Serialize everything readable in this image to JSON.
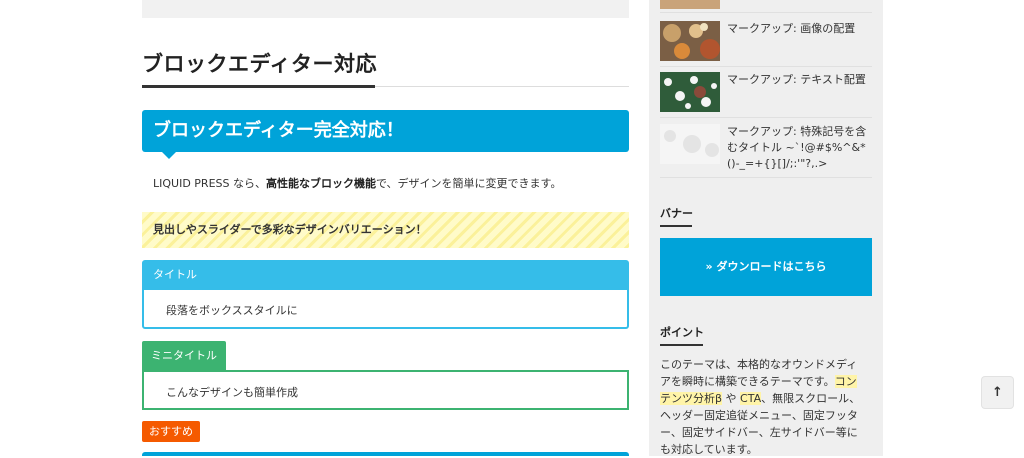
{
  "main": {
    "section_title": "ブロックエディター対応",
    "blue_heading": "ブロックエディター完全対応！",
    "paragraph": {
      "before": "LIQUID PRESS なら、",
      "bold": "高性能なブロック機能",
      "after": "で、デザインを簡単に変更できます。"
    },
    "stripe_text": "見出しやスライダーで多彩なデザインバリエーション！",
    "box_title": "タイトル",
    "box_body": "段落をボックススタイルに",
    "mini_title": "ミニタイトル",
    "mini_body": "こんなデザインも簡単作成",
    "badge": "おすすめ"
  },
  "sidebar": {
    "posts": [
      {
        "title": "マークアップ: 画像の配置"
      },
      {
        "title": "マークアップ: テキスト配置"
      },
      {
        "title": "マークアップ: 特殊記号を含むタイトル ~`!@#$%^&*()-_=+{}[]/;:'\"?,.>"
      }
    ],
    "banner_heading": "バナー",
    "download_label": "» ダウンロードはこちら",
    "point_heading": "ポイント",
    "point_text": {
      "p1": "このテーマは、本格的なオウンドメディアを瞬時に構築できるテーマです。",
      "hl1": "コンテンツ分析β",
      "p2": " や ",
      "hl2": "CTA",
      "p3": "、無限スクロール、ヘッダー固定追従メニュー、固定フッター、固定サイドバー、左サイドバー等にも対応しています。"
    }
  },
  "back_to_top": "↑",
  "colors": {
    "accent": "#00a3d9",
    "box_blue": "#35bde9",
    "green": "#3cb371",
    "badge_orange": "#f55a00"
  }
}
